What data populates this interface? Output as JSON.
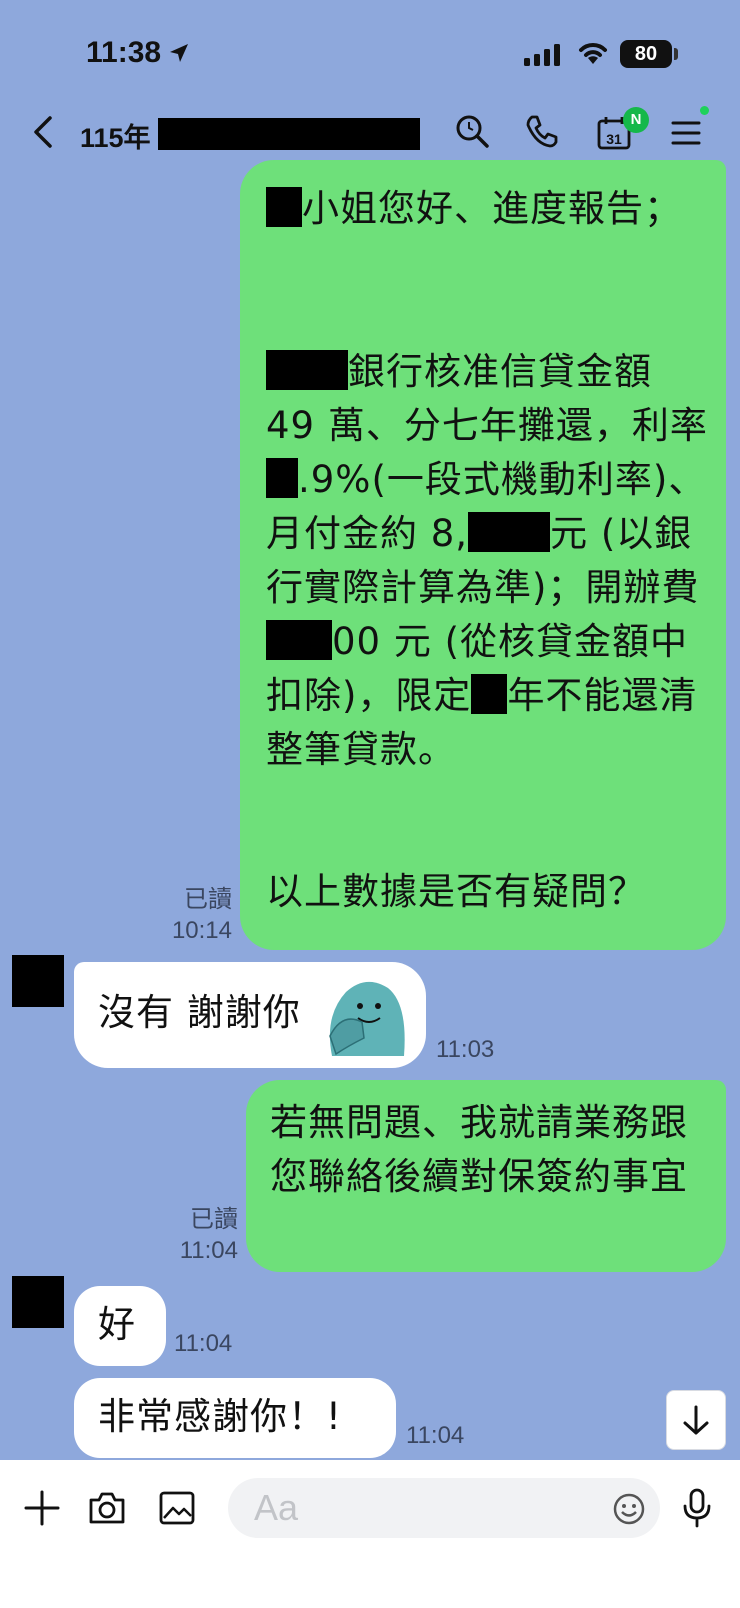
{
  "status_bar": {
    "time": "11:38",
    "battery": "80"
  },
  "header": {
    "title": "115年",
    "calendar_day": "31",
    "calendar_badge": "N"
  },
  "messages": [
    {
      "side": "right",
      "read": "已讀",
      "time": "10:14",
      "lines": [
        "小姐您好、進度報告；",
        "",
        "銀行核准信貸金額 49 萬、分七年攤還，利率 ",
        ".9%(一段式機動利率)、月付金約 8,",
        "元 (以銀行實際計算為準)；開辦費 ",
        "00 元 (從核貸金額中扣除)，限定",
        "年不能還清整筆貸款。",
        "以上數據是否有疑問？"
      ]
    },
    {
      "side": "left",
      "text": "沒有 謝謝你",
      "time": "11:03"
    },
    {
      "side": "right",
      "read": "已讀",
      "time": "11:04",
      "text": "若無問題、我就請業務跟您聯絡後續對保簽約事宜"
    },
    {
      "side": "left",
      "text": "好",
      "time": "11:04"
    },
    {
      "side": "left",
      "text": "非常感謝你！!",
      "time": "11:04"
    }
  ],
  "input": {
    "placeholder": "Aa"
  },
  "icons": [
    "back-icon",
    "search-icon",
    "phone-icon",
    "calendar-icon",
    "menu-icon",
    "plus-icon",
    "camera-icon",
    "image-icon",
    "emoji-icon",
    "mic-icon",
    "arrow-down-icon"
  ]
}
